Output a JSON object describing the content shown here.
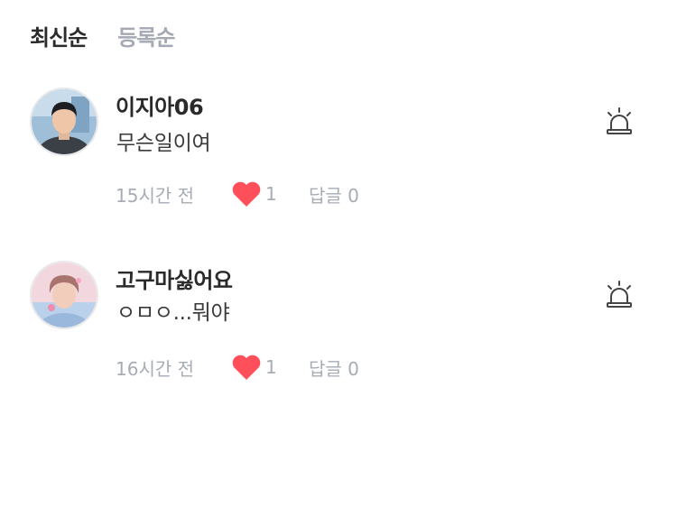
{
  "sort": {
    "latest": "최신순",
    "registered": "등록순"
  },
  "colors": {
    "heart": "#ff4f5a",
    "muted": "#a7acb5",
    "text": "#2a2a2a"
  },
  "comments": [
    {
      "author": "이지아06",
      "text": "무슨일이여",
      "time": "15시간 전",
      "likes": "1",
      "reply_label": "답글 0",
      "avatar_icon": "profile-photo",
      "report_icon": "siren-icon"
    },
    {
      "author": "고구마싫어요",
      "text": "ㅇㅁㅇ...뭐야",
      "time": "16시간 전",
      "likes": "1",
      "reply_label": "답글 0",
      "avatar_icon": "profile-photo",
      "report_icon": "siren-icon"
    }
  ]
}
